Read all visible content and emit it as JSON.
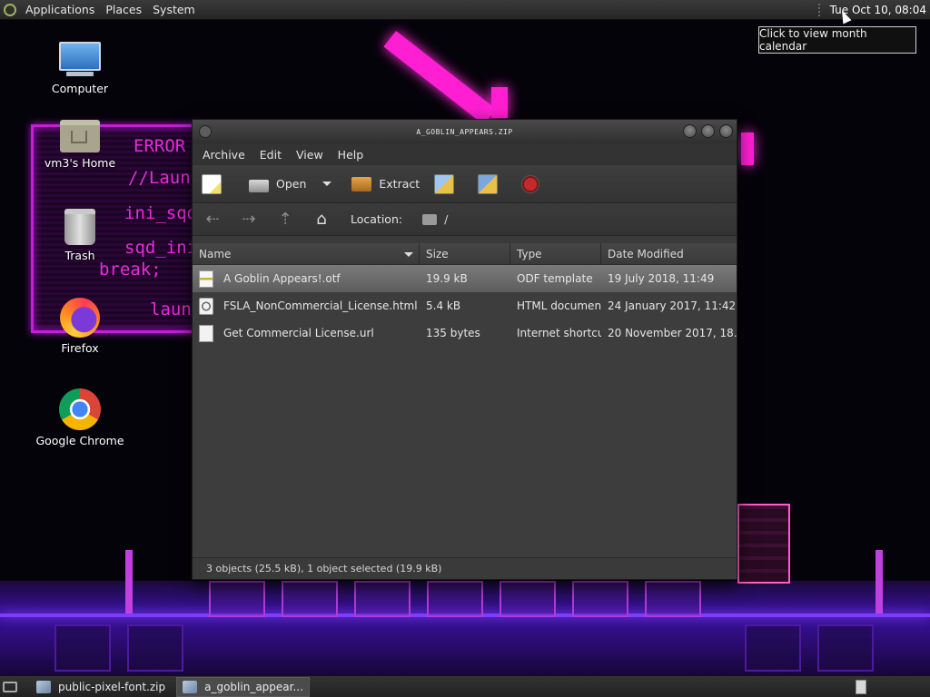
{
  "top_panel": {
    "menus": [
      "Applications",
      "Places",
      "System"
    ],
    "clock": "Tue Oct 10, 08:04",
    "tooltip": "Click to view month calendar"
  },
  "desktop_icons": [
    {
      "label": "Computer",
      "icon": "computer-icon"
    },
    {
      "label": "vm3's Home",
      "icon": "home-folder-icon"
    },
    {
      "label": "Trash",
      "icon": "trash-icon"
    },
    {
      "label": "Firefox",
      "icon": "firefox-icon"
    },
    {
      "label": "Google Chrome",
      "icon": "chrome-icon"
    }
  ],
  "wallpaper_text": [
    "ERROR",
    "//Launc",
    "ini_sqd(",
    "sqd_ini",
    "break;",
    "laun"
  ],
  "window": {
    "title": "a_goblin_appears.zip",
    "menu": [
      "Archive",
      "Edit",
      "View",
      "Help"
    ],
    "toolbar": {
      "open_label": "Open",
      "extract_label": "Extract"
    },
    "location": {
      "label": "Location:",
      "path": "/"
    },
    "columns": [
      "Name",
      "Size",
      "Type",
      "Date Modified"
    ],
    "files": [
      {
        "name": "A Goblin Appears!.otf",
        "size": "19.9 kB",
        "type": "ODF template",
        "date": "19 July 2018, 11:49",
        "icon": "otf-file-icon",
        "selected": true
      },
      {
        "name": "FSLA_NonCommercial_License.html",
        "size": "5.4 kB",
        "type": "HTML document",
        "date": "24 January 2017, 11:42",
        "icon": "html-file-icon",
        "selected": false
      },
      {
        "name": "Get Commercial License.url",
        "size": "135 bytes",
        "type": "Internet shortcut",
        "date": "20 November 2017, 18…",
        "icon": "file-icon",
        "selected": false
      }
    ],
    "status": "3 objects (25.5 kB), 1 object selected (19.9 kB)"
  },
  "taskbar": {
    "tasks": [
      {
        "label": "public-pixel-font.zip",
        "active": false
      },
      {
        "label": "a_goblin_appear...",
        "active": true
      }
    ]
  }
}
